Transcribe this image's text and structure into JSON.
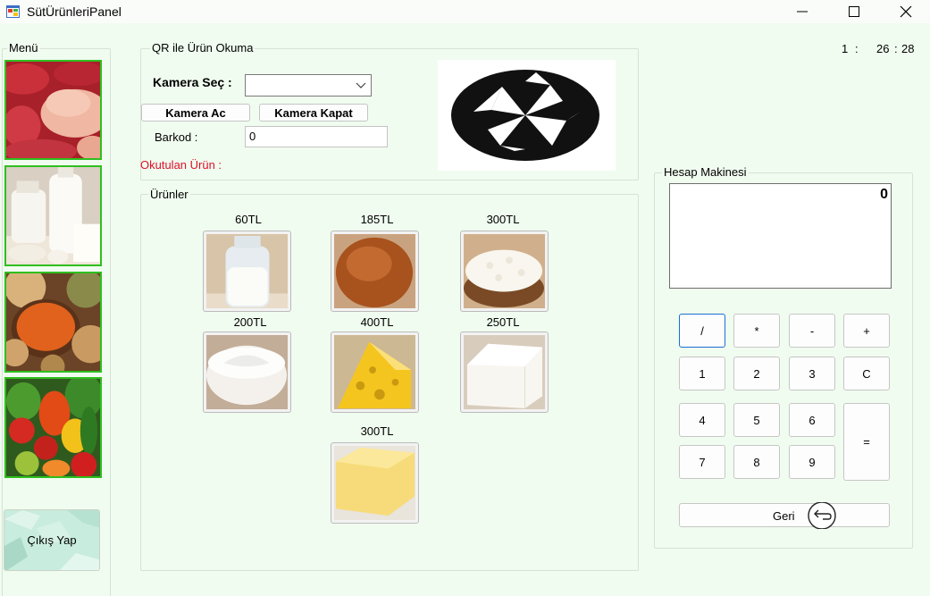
{
  "window": {
    "title": "SütÜrünleriPanel"
  },
  "menu": {
    "title": "Menü",
    "tiles": [
      {
        "name": "meat"
      },
      {
        "name": "dairy"
      },
      {
        "name": "legumes"
      },
      {
        "name": "vegetables"
      }
    ],
    "exit_label": "Çıkış Yap"
  },
  "clock": {
    "hours": "1",
    "sep1": ":",
    "minutes": "26",
    "sep2": ":",
    "seconds": "28"
  },
  "qr": {
    "title": "QR ile Ürün Okuma",
    "camera_select_label": "Kamera Seç :",
    "camera_select_value": "",
    "open_camera_label": "Kamera Ac",
    "close_camera_label": "Kamera Kapat",
    "barcode_label": "Barkod :",
    "barcode_value": "0",
    "scanned_product_label": "Okutulan Ürün :",
    "scanned_color": "#e0102b"
  },
  "products": {
    "title": "Ürünler",
    "items": [
      {
        "name": "milk",
        "price": "60TL"
      },
      {
        "name": "egg",
        "price": "185TL"
      },
      {
        "name": "cottage-cheese",
        "price": "300TL"
      },
      {
        "name": "yogurt",
        "price": "200TL"
      },
      {
        "name": "yellow-cheese",
        "price": "400TL"
      },
      {
        "name": "white-cheese",
        "price": "250TL"
      },
      {
        "name": "butter",
        "price": "300TL"
      }
    ]
  },
  "calculator": {
    "title": "Hesap Makinesi",
    "display": "0",
    "keys": {
      "div": "/",
      "mul": "*",
      "sub": "-",
      "add": "+",
      "k1": "1",
      "k2": "2",
      "k3": "3",
      "clear": "C",
      "k4": "4",
      "k5": "5",
      "k6": "6",
      "eq": "=",
      "k7": "7",
      "k8": "8",
      "k9": "9"
    },
    "back_label": "Geri"
  },
  "colors": {
    "background": "#f0fcef",
    "menu_border": "#2fbf1f",
    "focus_border": "#1a6fd6"
  }
}
